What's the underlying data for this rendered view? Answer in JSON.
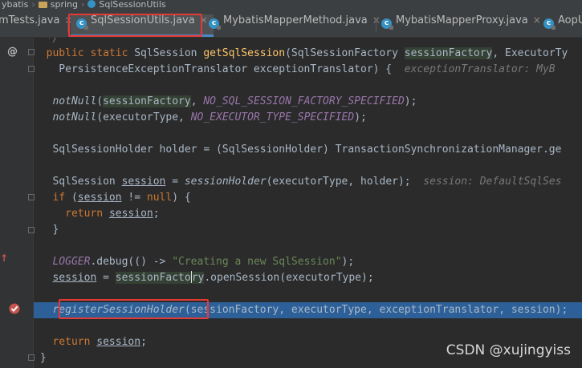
{
  "breadcrumb": [
    "ybatis",
    "spring",
    "SqlSessionUtils"
  ],
  "tabs": [
    {
      "label": "mTests.java",
      "icon": "java-class-icon"
    },
    {
      "label": "SqlSessionUtils.java",
      "icon": "java-class-icon",
      "active": true
    },
    {
      "label": "MybatisMapperMethod.java",
      "icon": "java-class-icon"
    },
    {
      "label": "MybatisMapperProxy.java",
      "icon": "java-class-icon"
    },
    {
      "label": "AopU",
      "icon": "java-class-icon"
    }
  ],
  "code": {
    "l_method": {
      "kw": "public static ",
      "type": "SqlSession ",
      "name": "getSqlSession",
      "p1": "(SqlSessionFactory ",
      "p1name": "sessionFactory",
      "p1rest": ", ExecutorTy"
    },
    "l_params": {
      "text": "    PersistenceExceptionTranslator exceptionTranslator) {  ",
      "hint": "exceptionTranslator: MyB"
    },
    "l_notnull1": {
      "fn": "notNull",
      "open": "(",
      "arg": "sessionFactory",
      "sep": ", ",
      "const": "NO_SQL_SESSION_FACTORY_SPECIFIED",
      "close": ");"
    },
    "l_notnull2": {
      "fn": "notNull",
      "open": "(executorType, ",
      "const": "NO_EXECUTOR_TYPE_SPECIFIED",
      "close": ");"
    },
    "l_holder": "SqlSessionHolder holder = (SqlSessionHolder) TransactionSynchronizationManager.ge",
    "l_session": {
      "a": "SqlSession ",
      "var": "session",
      "b": " = ",
      "fn": "sessionHolder",
      "c": "(executorType, holder);  ",
      "hint": "session: DefaultSqlSes"
    },
    "l_if": {
      "kw": "if ",
      "a": "(",
      "var": "session",
      "b": " != ",
      "kw2": "null",
      "c": ") {"
    },
    "l_return1": {
      "kw": "return ",
      "var": "session",
      "c": ";"
    },
    "l_brace": "}",
    "l_logger": {
      "const": "LOGGER",
      "a": ".debug(() -> ",
      "str": "\"Creating a new SqlSession\"",
      "c": ");"
    },
    "l_open": {
      "var": "session",
      "a": " = ",
      "var2": "sessionFacto",
      "var2b": "ry",
      "c": ".openSession(executorType);"
    },
    "l_register": {
      "fn": "registerSessionHolder",
      "c": "(sessionFactory, executorType, exceptionTranslator, session);"
    },
    "l_return2": {
      "kw": "return ",
      "var": "session",
      "c": ";"
    },
    "l_end": "}"
  },
  "gutter": {
    "annotation_symbol": "@"
  },
  "watermark": "CSDN @xujingyiss",
  "colors": {
    "highlight": "#2d6099",
    "redbox": "#e53935",
    "keyword": "#cc7832",
    "function": "#ffc66d"
  }
}
